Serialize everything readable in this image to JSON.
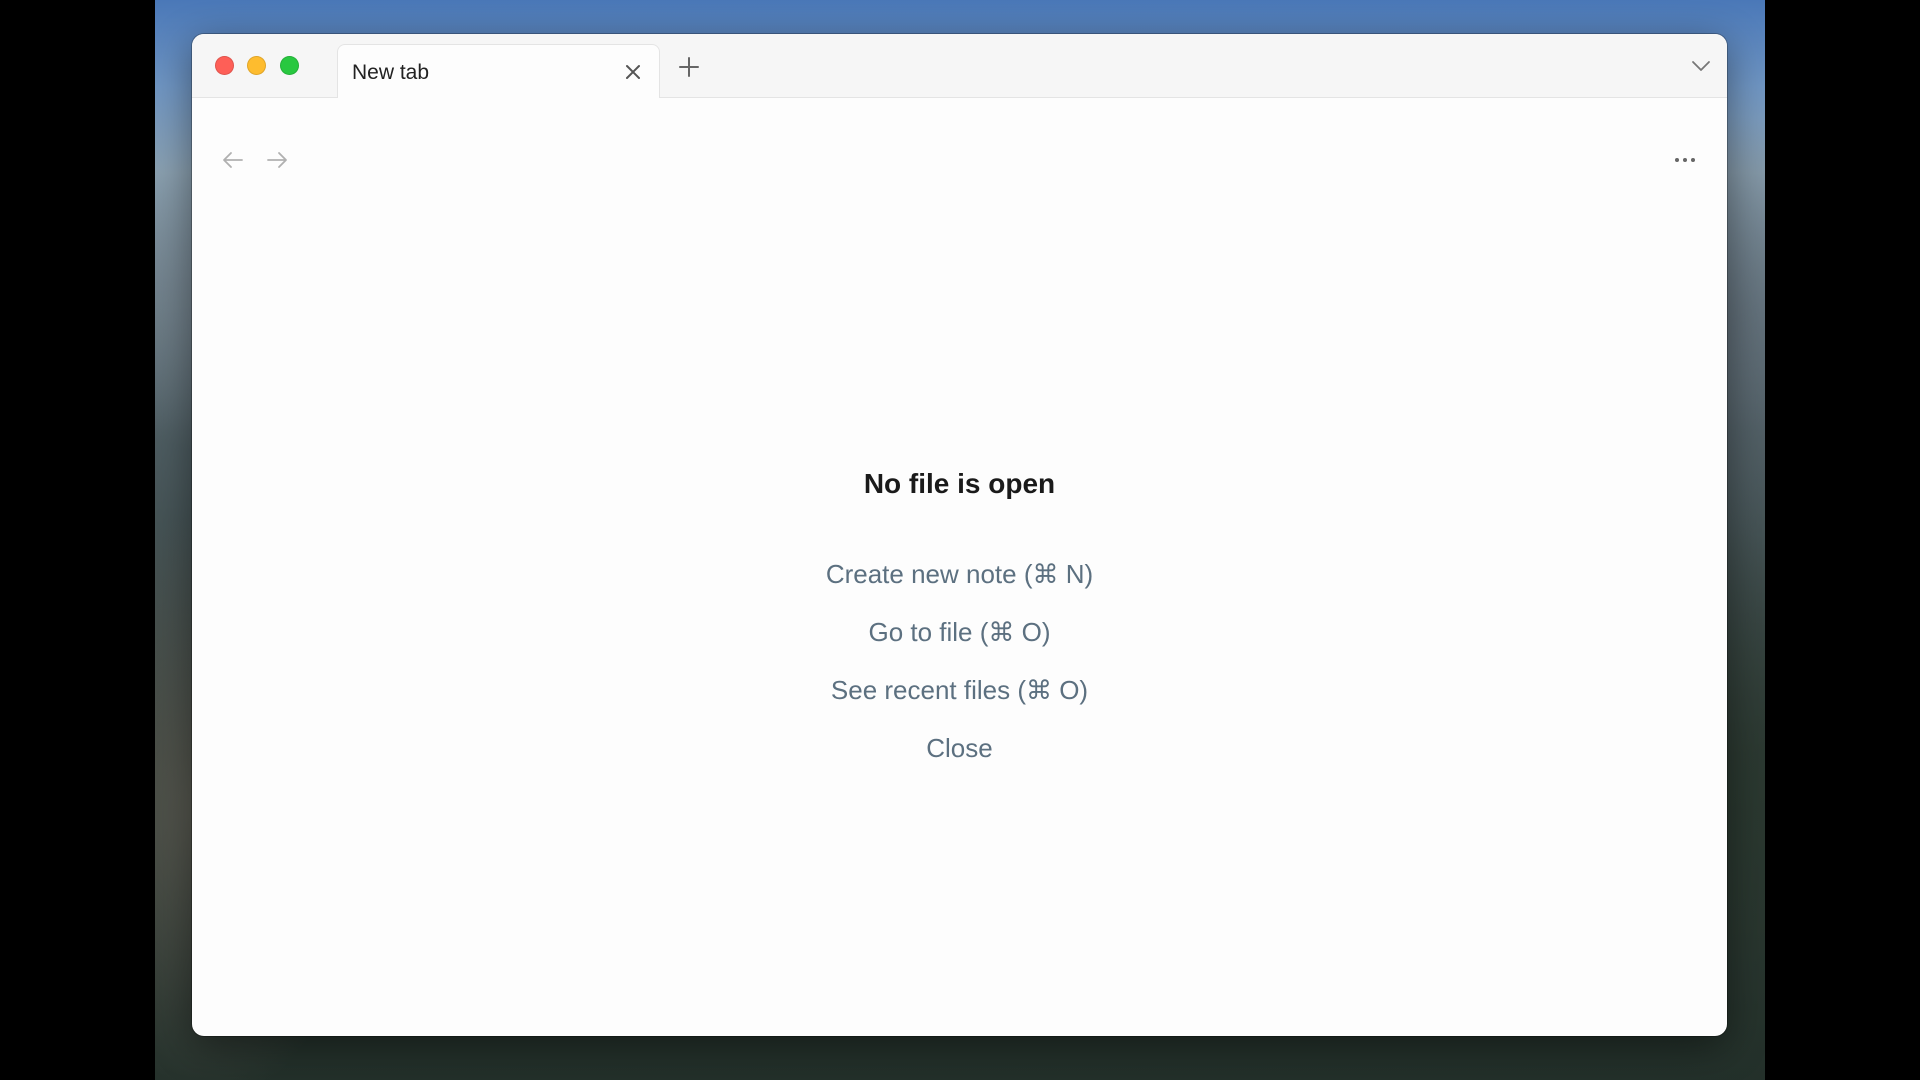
{
  "window": {
    "tab": {
      "title": "New tab"
    }
  },
  "empty_state": {
    "title": "No file is open",
    "actions": [
      {
        "label": "Create new note (⌘ N)"
      },
      {
        "label": "Go to file (⌘ O)"
      },
      {
        "label": "See recent files (⌘ O)"
      },
      {
        "label": "Close"
      }
    ]
  },
  "icons": {
    "tab_close": "close-icon",
    "new_tab": "plus-icon",
    "tab_list": "chevron-down-icon",
    "back": "arrow-left-icon",
    "forward": "arrow-right-icon",
    "more": "more-options-icon"
  },
  "colors": {
    "close": "#fe5f57",
    "minimize": "#febc2e",
    "zoom": "#28c840",
    "action_text": "#5c7080"
  }
}
